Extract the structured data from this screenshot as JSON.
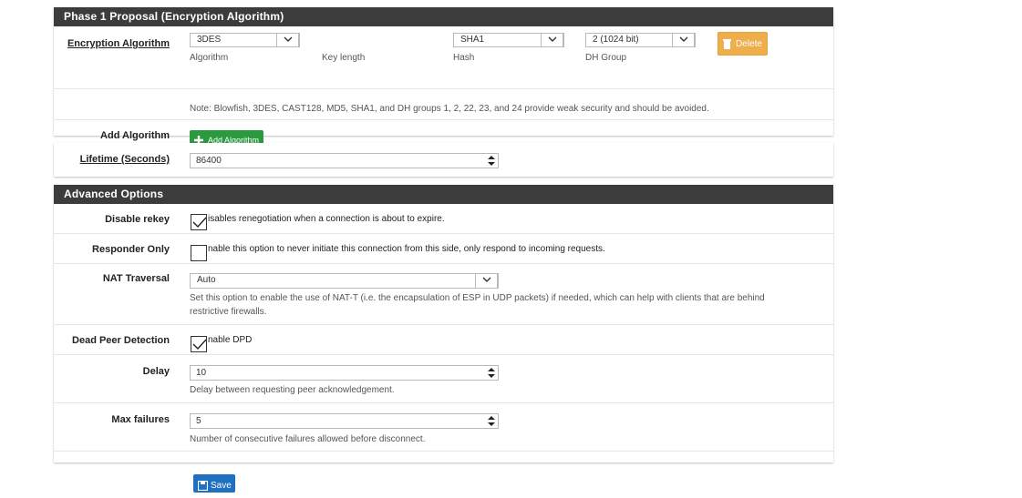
{
  "phase1": {
    "heading": "Phase 1 Proposal (Encryption Algorithm)",
    "encryption_label": "Encryption Algorithm",
    "algorithm": {
      "value": "3DES",
      "caption": "Algorithm"
    },
    "key_length": {
      "caption": "Key length"
    },
    "hash": {
      "value": "SHA1",
      "caption": "Hash"
    },
    "dh_group": {
      "value": "2 (1024 bit)",
      "caption": "DH Group"
    },
    "delete_label": "Delete",
    "note": "Note: Blowfish, 3DES, CAST128, MD5, SHA1, and DH groups 1, 2, 22, 23, and 24 provide weak security and should be avoided.",
    "add_algorithm_label": "Add Algorithm",
    "add_algorithm_button": "Add Algorithm"
  },
  "lifetime": {
    "label": "Lifetime (Seconds)",
    "value": "86400"
  },
  "advanced": {
    "heading": "Advanced Options",
    "disable_rekey": {
      "label": "Disable rekey",
      "text": "isables renegotiation when a connection is about to expire.",
      "checked": true
    },
    "responder_only": {
      "label": "Responder Only",
      "text": "nable this option to never initiate this connection from this side, only respond to incoming requests.",
      "checked": false
    },
    "nat_traversal": {
      "label": "NAT Traversal",
      "value": "Auto",
      "help_line1": "Set this option to enable the use of NAT-T (i.e. the encapsulation of ESP in UDP packets) if needed, which can help with clients that are behind",
      "help_line2": "restrictive firewalls."
    },
    "dpd": {
      "label": "Dead Peer Detection",
      "text": "nable DPD",
      "checked": true
    },
    "delay": {
      "label": "Delay",
      "value": "10",
      "help": "Delay between requesting peer acknowledgement."
    },
    "max_failures": {
      "label": "Max failures",
      "value": "5",
      "help": "Number of consecutive failures allowed before disconnect."
    }
  },
  "save_label": "Save",
  "colors": {
    "heading_bg": "#3c3c3c",
    "green": "#2b9a3e",
    "orange": "#eeae4c",
    "blue": "#1f70c1"
  }
}
